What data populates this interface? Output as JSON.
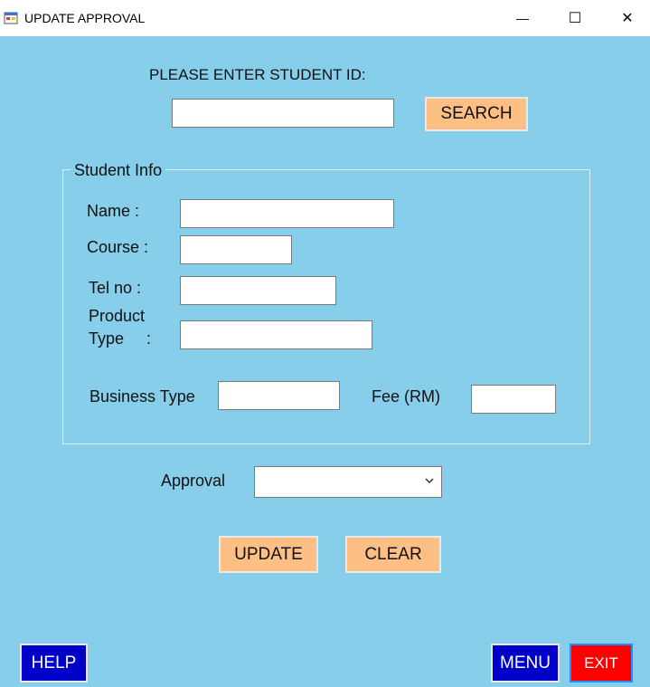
{
  "window": {
    "title": "UPDATE APPROVAL",
    "minimize_glyph": "—",
    "maximize_glyph": "☐",
    "close_glyph": "✕"
  },
  "search": {
    "prompt": "PLEASE ENTER STUDENT ID:",
    "value": "",
    "button": "SEARCH"
  },
  "student_info": {
    "group_title": "Student Info",
    "name_label": "Name :",
    "name_value": "",
    "course_label": "Course :",
    "course_value": "",
    "tel_label": "Tel no :",
    "tel_value": "",
    "product_label_line1": "Product",
    "product_label_line2": "Type     :",
    "product_value": "",
    "business_label": "Business Type",
    "business_value": "",
    "fee_label": "Fee (RM)",
    "fee_value": ""
  },
  "approval": {
    "label": "Approval",
    "selected": ""
  },
  "actions": {
    "update": "UPDATE",
    "clear": "CLEAR",
    "help": "HELP",
    "menu": "MENU",
    "exit": "EXIT"
  },
  "icons": {
    "app": "app-window-icon",
    "dropdown": "chevron-down-icon"
  },
  "colors": {
    "background": "#87ceeb",
    "orange_button": "#fdbf83",
    "blue_button": "#0000c8",
    "red_button": "#ff0000"
  }
}
